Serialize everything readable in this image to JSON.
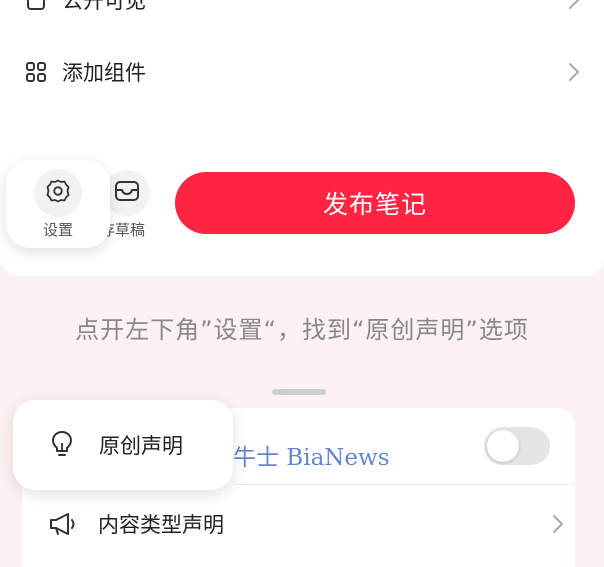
{
  "rows": {
    "public": {
      "label": "公开可见"
    },
    "widget": {
      "label": "添加组件"
    }
  },
  "bottom_bar": {
    "settings_label": "设置",
    "draft_label": "存草稿",
    "publish_label": "发布笔记"
  },
  "instruction": "点开左下角”设置“，找到“原创声明”选项",
  "sheet": {
    "original_label": "原创声明",
    "original_toggle_on": false,
    "content_type_label": "内容类型声明"
  },
  "watermark": "鞭牛士 BiaNews",
  "colors": {
    "accent": "#ff2442",
    "background_tint": "#fdf1f1",
    "watermark": "#4a72c4"
  },
  "icons": {
    "public": "lock-icon",
    "widget": "grid-icon",
    "settings": "gear-icon",
    "draft": "inbox-icon",
    "original": "lightbulb-icon",
    "content_type": "megaphone-icon",
    "chevron": "chevron-right-icon"
  }
}
